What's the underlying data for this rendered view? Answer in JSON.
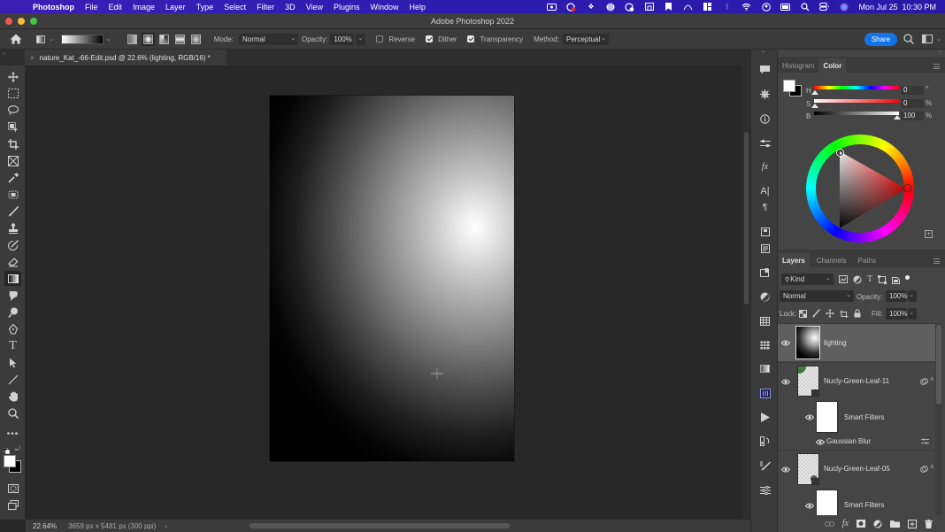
{
  "menubar": {
    "app": "Photoshop",
    "items": [
      "File",
      "Edit",
      "Image",
      "Layer",
      "Type",
      "Select",
      "Filter",
      "3D",
      "View",
      "Plugins",
      "Window",
      "Help"
    ],
    "status_icons": [
      "screen-record-icon",
      "creative-cloud-icon",
      "dropbox-icon",
      "globe-icon",
      "sync-icon",
      "screen-share-icon",
      "bookmark-icon",
      "airplay-icon",
      "tiles-icon",
      "bluetooth-icon",
      "wifi-icon",
      "user-icon",
      "battery-icon",
      "spotlight-search-icon",
      "control-center-icon",
      "siri-icon"
    ],
    "datetime": "Mon Jul 25  10:30 PM"
  },
  "window": {
    "title": "Adobe Photoshop 2022"
  },
  "options": {
    "mode_label": "Mode:",
    "mode_value": "Normal",
    "opacity_label": "Opacity:",
    "opacity_value": "100%",
    "reverse_label": "Reverse",
    "reverse_checked": false,
    "dither_label": "Dither",
    "dither_checked": true,
    "transparency_label": "Transparency",
    "transparency_checked": true,
    "method_label": "Method:",
    "method_value": "Perceptual",
    "share_label": "Share",
    "gradient_types": [
      "linear-gradient",
      "radial-gradient",
      "angle-gradient",
      "reflected-gradient",
      "diamond-gradient"
    ],
    "active_gradient_type": "radial-gradient"
  },
  "document": {
    "tab_title": "nature_Kat_-66-Edit.psd @ 22.6% (lighting, RGB/16) *",
    "zoom": "22.64%",
    "info": "3659 px x 5481 px (300 ppi)"
  },
  "tools": [
    "move",
    "marquee",
    "lasso",
    "object-selection",
    "crop",
    "frame",
    "eyedropper",
    "healing-brush",
    "brush",
    "clone-stamp",
    "history-brush",
    "eraser",
    "gradient",
    "smudge",
    "dodge",
    "pen",
    "type",
    "path-selection",
    "line",
    "hand",
    "zoom",
    "more"
  ],
  "active_tool": "gradient",
  "colors": {
    "accent": "#1473e6",
    "menubar": "#3a1fb5",
    "foreground": "#ffffff",
    "background": "#000000"
  },
  "color_panel": {
    "tabs": [
      "Histogram",
      "Color"
    ],
    "active_tab": "Color",
    "h_label": "H",
    "h_value": "0",
    "h_unit": "°",
    "s_label": "S",
    "s_value": "0",
    "s_unit": "%",
    "b_label": "B",
    "b_value": "100",
    "b_unit": "%"
  },
  "layers_panel": {
    "tabs": [
      "Layers",
      "Channels",
      "Paths"
    ],
    "active_tab": "Layers",
    "filter_label": "Kind",
    "blend_mode": "Normal",
    "opacity_label": "Opacity:",
    "opacity_value": "100%",
    "lock_label": "Lock:",
    "fill_label": "Fill:",
    "fill_value": "100%",
    "layers": [
      {
        "name": "lighting",
        "selected": true,
        "visible": true
      },
      {
        "name": "Nucly-Green-Leaf-11",
        "selected": false,
        "visible": true,
        "smart_object": true
      },
      {
        "name": "Smart Filters",
        "sub": true
      },
      {
        "name": "Gaussian Blur",
        "filter": true
      },
      {
        "name": "Nucly-Green-Leaf-05",
        "selected": false,
        "visible": true,
        "smart_object": true
      },
      {
        "name": "Smart Filters",
        "sub": true
      }
    ]
  }
}
